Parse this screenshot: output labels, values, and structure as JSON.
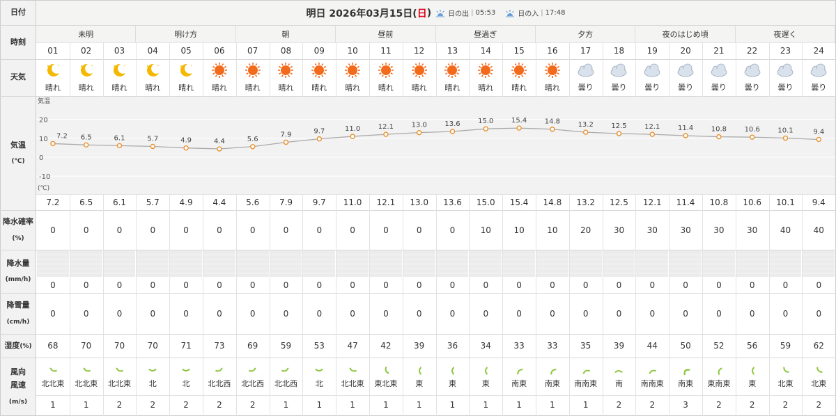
{
  "labels": {
    "date": "日付",
    "time": "時刻",
    "weather": "天気",
    "temp": "気温",
    "temp_unit": "(℃)",
    "precip_prob": "降水確率",
    "precip_prob_unit": "(%)",
    "rain": "降水量",
    "rain_unit": "(mm/h)",
    "snow": "降雪量",
    "snow_unit": "(cm/h)",
    "humidity": "湿度",
    "humidity_unit": "(%)",
    "wind_dir": "風向",
    "wind_speed": "風速",
    "wind_unit": "(m/s)"
  },
  "header": {
    "prefix": "明日 2026年03月15日(",
    "day": "日",
    "suffix": ")",
    "sunrise_label": "日の出",
    "sunrise": "05:53",
    "sunset_label": "日の入",
    "sunset": "17:48",
    "sep": "|"
  },
  "periods": [
    {
      "label": "未明",
      "span": 3
    },
    {
      "label": "明け方",
      "span": 3
    },
    {
      "label": "朝",
      "span": 3
    },
    {
      "label": "昼前",
      "span": 3
    },
    {
      "label": "昼過ぎ",
      "span": 3
    },
    {
      "label": "夕方",
      "span": 3
    },
    {
      "label": "夜のはじめ頃",
      "span": 3
    },
    {
      "label": "夜遅く",
      "span": 3
    }
  ],
  "hours": [
    "01",
    "02",
    "03",
    "04",
    "05",
    "06",
    "07",
    "08",
    "09",
    "10",
    "11",
    "12",
    "13",
    "14",
    "15",
    "16",
    "17",
    "18",
    "19",
    "20",
    "21",
    "22",
    "23",
    "24"
  ],
  "weather": [
    {
      "icon": "moon-icon",
      "text": "晴れ"
    },
    {
      "icon": "moon-icon",
      "text": "晴れ"
    },
    {
      "icon": "moon-icon",
      "text": "晴れ"
    },
    {
      "icon": "moon-icon",
      "text": "晴れ"
    },
    {
      "icon": "moon-icon",
      "text": "晴れ"
    },
    {
      "icon": "sun-icon",
      "text": "晴れ"
    },
    {
      "icon": "sun-icon",
      "text": "晴れ"
    },
    {
      "icon": "sun-icon",
      "text": "晴れ"
    },
    {
      "icon": "sun-icon",
      "text": "晴れ"
    },
    {
      "icon": "sun-icon",
      "text": "晴れ"
    },
    {
      "icon": "sun-icon",
      "text": "晴れ"
    },
    {
      "icon": "sun-icon",
      "text": "晴れ"
    },
    {
      "icon": "sun-icon",
      "text": "晴れ"
    },
    {
      "icon": "sun-icon",
      "text": "晴れ"
    },
    {
      "icon": "sun-icon",
      "text": "晴れ"
    },
    {
      "icon": "sun-icon",
      "text": "晴れ"
    },
    {
      "icon": "cloud-icon",
      "text": "曇り"
    },
    {
      "icon": "cloud-icon",
      "text": "曇り"
    },
    {
      "icon": "cloud-icon",
      "text": "曇り"
    },
    {
      "icon": "cloud-icon",
      "text": "曇り"
    },
    {
      "icon": "cloud-icon",
      "text": "曇り"
    },
    {
      "icon": "cloud-icon",
      "text": "曇り"
    },
    {
      "icon": "cloud-icon",
      "text": "曇り"
    },
    {
      "icon": "cloud-icon",
      "text": "曇り"
    }
  ],
  "chart_data": {
    "type": "line",
    "x": [
      "01",
      "02",
      "03",
      "04",
      "05",
      "06",
      "07",
      "08",
      "09",
      "10",
      "11",
      "12",
      "13",
      "14",
      "15",
      "16",
      "17",
      "18",
      "19",
      "20",
      "21",
      "22",
      "23",
      "24"
    ],
    "values": [
      7.2,
      6.5,
      6.1,
      5.7,
      4.9,
      4.4,
      5.6,
      7.9,
      9.7,
      11.0,
      12.1,
      13.0,
      13.6,
      15.0,
      15.4,
      14.8,
      13.2,
      12.5,
      12.1,
      11.4,
      10.8,
      10.6,
      10.1,
      9.4
    ],
    "value_labels": [
      "7.2",
      "6.5",
      "6.1",
      "5.7",
      "4.9",
      "4.4",
      "5.6",
      "7.9",
      "9.7",
      "11.0",
      "12.1",
      "13.0",
      "13.6",
      "15.0",
      "15.4",
      "14.8",
      "13.2",
      "12.5",
      "12.1",
      "11.4",
      "10.8",
      "10.6",
      "10.1",
      "9.4"
    ],
    "ylabel": "気温",
    "yunit": "(℃)",
    "yticks": [
      "20",
      "10",
      "0",
      "-10"
    ],
    "ylim": [
      -10,
      20
    ],
    "grid": true,
    "line_color": "#aaaaaa",
    "point_color": "#e8902b"
  },
  "temps": [
    "7.2",
    "6.5",
    "6.1",
    "5.7",
    "4.9",
    "4.4",
    "5.6",
    "7.9",
    "9.7",
    "11.0",
    "12.1",
    "13.0",
    "13.6",
    "15.0",
    "15.4",
    "14.8",
    "13.2",
    "12.5",
    "12.1",
    "11.4",
    "10.8",
    "10.6",
    "10.1",
    "9.4"
  ],
  "precip_prob": [
    "0",
    "0",
    "0",
    "0",
    "0",
    "0",
    "0",
    "0",
    "0",
    "0",
    "0",
    "0",
    "0",
    "10",
    "10",
    "10",
    "20",
    "30",
    "30",
    "30",
    "30",
    "30",
    "40",
    "40"
  ],
  "rain": [
    "0",
    "0",
    "0",
    "0",
    "0",
    "0",
    "0",
    "0",
    "0",
    "0",
    "0",
    "0",
    "0",
    "0",
    "0",
    "0",
    "0",
    "0",
    "0",
    "0",
    "0",
    "0",
    "0",
    "0"
  ],
  "snow": [
    "0",
    "0",
    "0",
    "0",
    "0",
    "0",
    "0",
    "0",
    "0",
    "0",
    "0",
    "0",
    "0",
    "0",
    "0",
    "0",
    "0",
    "0",
    "0",
    "0",
    "0",
    "0",
    "0",
    "0"
  ],
  "humidity": [
    "68",
    "70",
    "70",
    "70",
    "71",
    "73",
    "69",
    "59",
    "53",
    "47",
    "42",
    "39",
    "36",
    "34",
    "33",
    "33",
    "35",
    "39",
    "44",
    "50",
    "52",
    "56",
    "59",
    "62"
  ],
  "wind_dir": [
    "北北東",
    "北北東",
    "北北東",
    "北",
    "北",
    "北北西",
    "北北西",
    "北北西",
    "北",
    "北北東",
    "東北東",
    "東",
    "東",
    "東",
    "南東",
    "南東",
    "南南東",
    "南",
    "南南東",
    "南東",
    "東南東",
    "東",
    "北東",
    "北東"
  ],
  "wind_speed": [
    "1",
    "1",
    "2",
    "2",
    "2",
    "2",
    "2",
    "1",
    "1",
    "1",
    "1",
    "1",
    "1",
    "1",
    "1",
    "1",
    "1",
    "2",
    "2",
    "3",
    "2",
    "2",
    "2",
    "2"
  ],
  "colors": {
    "wind_arrow": "#8cc63f",
    "sun": "#f26b1d",
    "moon": "#f5b800",
    "cloud": "#d9e2ec",
    "sunday": "#e0001a"
  }
}
